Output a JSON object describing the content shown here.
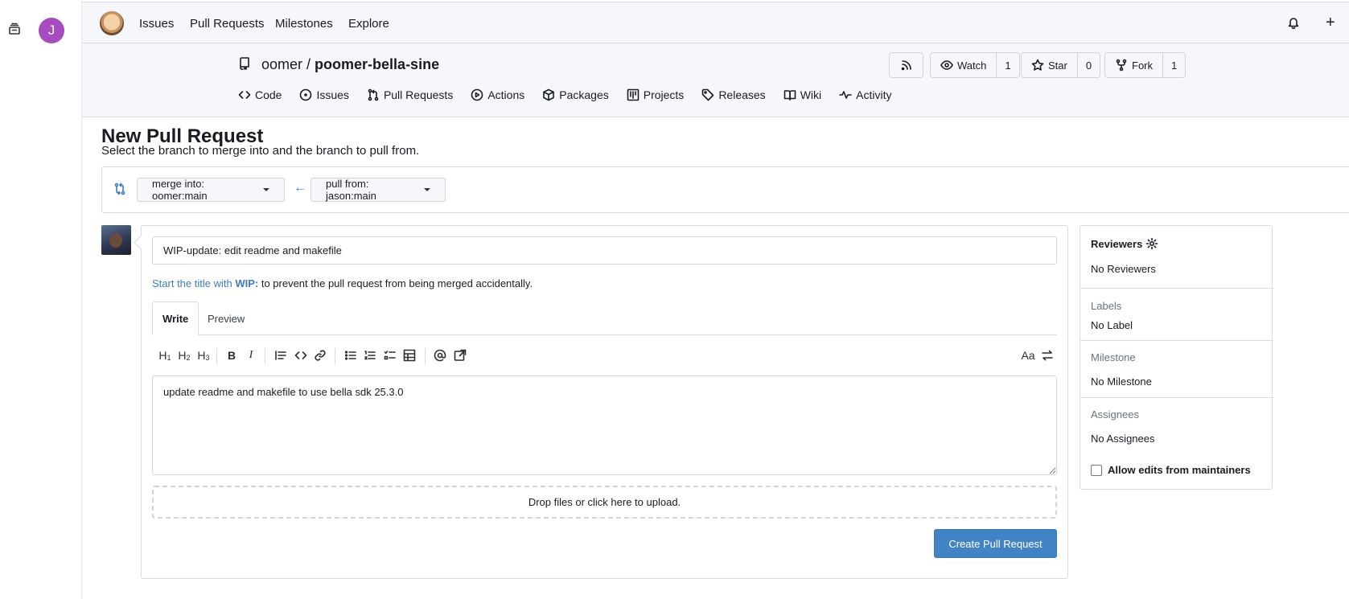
{
  "browser": {
    "profile_initial": "J"
  },
  "topnav": {
    "items": [
      "Issues",
      "Pull Requests",
      "Milestones",
      "Explore"
    ],
    "plus_label": "+"
  },
  "repo": {
    "owner": "oomer",
    "separator": " / ",
    "name": "poomer-bella-sine",
    "watch_label": "Watch",
    "watch_count": "1",
    "star_label": "Star",
    "star_count": "0",
    "fork_label": "Fork",
    "fork_count": "1",
    "tabs": [
      {
        "label": "Code",
        "icon": "code-icon"
      },
      {
        "label": "Issues",
        "icon": "issue-opened-icon"
      },
      {
        "label": "Pull Requests",
        "icon": "git-pull-request-icon"
      },
      {
        "label": "Actions",
        "icon": "play-icon"
      },
      {
        "label": "Packages",
        "icon": "package-icon"
      },
      {
        "label": "Projects",
        "icon": "project-icon"
      },
      {
        "label": "Releases",
        "icon": "tag-icon"
      },
      {
        "label": "Wiki",
        "icon": "book-icon"
      },
      {
        "label": "Activity",
        "icon": "pulse-icon"
      }
    ]
  },
  "page": {
    "title": "New Pull Request",
    "subtitle": "Select the branch to merge into and the branch to pull from."
  },
  "compare": {
    "base_label": "merge into: oomer:main",
    "head_label": "pull from: jason:main",
    "arrow": "←"
  },
  "form": {
    "title_value": "WIP-update: edit readme and makefile",
    "wip_hint_link": "Start the title with ",
    "wip_hint_keyword": "WIP:",
    "wip_hint_rest": " to prevent the pull request from being merged accidentally.",
    "tab_write": "Write",
    "tab_preview": "Preview",
    "body_value": "update readme and makefile to use bella sdk 25.3.0",
    "dropzone_text": "Drop files or click here to upload.",
    "submit_label": "Create Pull Request",
    "toolbar": {
      "h1": "H1",
      "h2": "H2",
      "h3": "H3",
      "bold": "B",
      "italic": "I",
      "font_toggle": "Aa"
    }
  },
  "sidebar": {
    "reviewers_label": "Reviewers",
    "reviewers_value": "No Reviewers",
    "labels_label": "Labels",
    "labels_value": "No Label",
    "milestone_label": "Milestone",
    "milestone_value": "No Milestone",
    "assignees_label": "Assignees",
    "assignees_value": "No Assignees",
    "allow_edits_label": "Allow edits from maintainers",
    "allow_edits_checked": false
  },
  "colors": {
    "accent": "#4183c4",
    "link": "#3d7ac5",
    "profile_avatar": "#a74bc1",
    "header_bg": "#f6f7fa"
  }
}
